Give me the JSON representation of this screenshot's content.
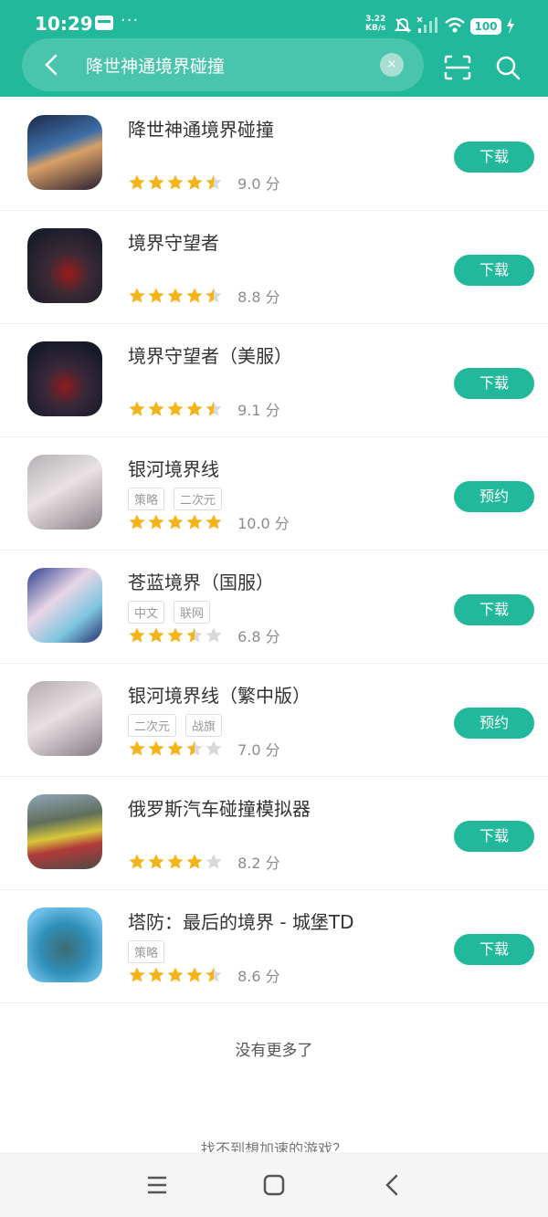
{
  "status_bar": {
    "time": "10:29",
    "speed_value": "3.22",
    "speed_unit": "KB/s",
    "battery": "100"
  },
  "search": {
    "query": "降世神通境界碰撞"
  },
  "colors": {
    "accent": "#21b89b",
    "star": "#f6b41b",
    "star_empty": "#d9d9d9"
  },
  "results": [
    {
      "name": "降世神通境界碰撞",
      "tags": [],
      "stars": 4.5,
      "score": "9.0 分",
      "button": "下载"
    },
    {
      "name": "境界守望者",
      "tags": [],
      "stars": 4.5,
      "score": "8.8 分",
      "button": "下载"
    },
    {
      "name": "境界守望者（美服）",
      "tags": [],
      "stars": 4.5,
      "score": "9.1 分",
      "button": "下载"
    },
    {
      "name": "银河境界线",
      "tags": [
        "策略",
        "二次元"
      ],
      "stars": 5,
      "score": "10.0 分",
      "button": "预约"
    },
    {
      "name": "苍蓝境界（国服）",
      "tags": [
        "中文",
        "联网"
      ],
      "stars": 3.5,
      "score": "6.8 分",
      "button": "下载"
    },
    {
      "name": "银河境界线（繁中版）",
      "tags": [
        "二次元",
        "战旗"
      ],
      "stars": 3.5,
      "score": "7.0 分",
      "button": "预约"
    },
    {
      "name": "俄罗斯汽车碰撞模拟器",
      "tags": [],
      "stars": 4,
      "score": "8.2 分",
      "button": "下载"
    },
    {
      "name": "塔防：最后的境界 - 城堡TD",
      "tags": [
        "策略"
      ],
      "stars": 4.5,
      "score": "8.6 分",
      "button": "下载"
    }
  ],
  "footer": {
    "no_more": "没有更多了",
    "cant_find": "找不到想加速的游戏？"
  }
}
